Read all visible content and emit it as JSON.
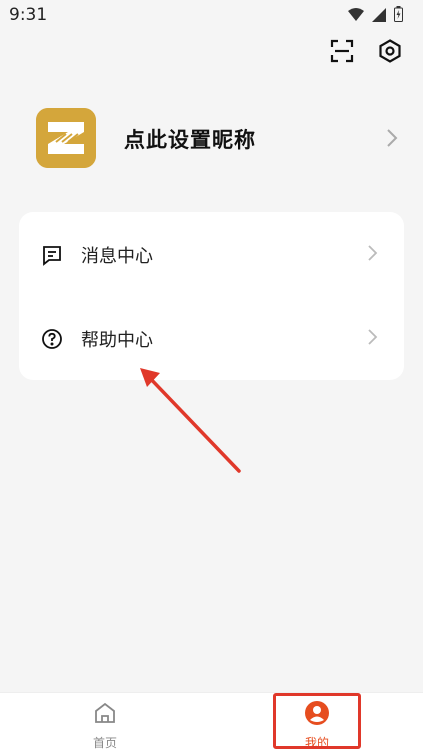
{
  "status_bar": {
    "time": "9:31"
  },
  "profile": {
    "nickname": "点此设置昵称"
  },
  "menu": {
    "items": [
      {
        "label": "消息中心",
        "icon": "message-icon"
      },
      {
        "label": "帮助中心",
        "icon": "help-icon"
      }
    ]
  },
  "tabbar": {
    "items": [
      {
        "label": "首页",
        "icon": "home-icon",
        "active": false
      },
      {
        "label": "我的",
        "icon": "user-icon",
        "active": true
      }
    ]
  },
  "colors": {
    "accent": "#e64d1f",
    "annotation": "#e0382a",
    "avatar_bg": "#d4a63b"
  }
}
